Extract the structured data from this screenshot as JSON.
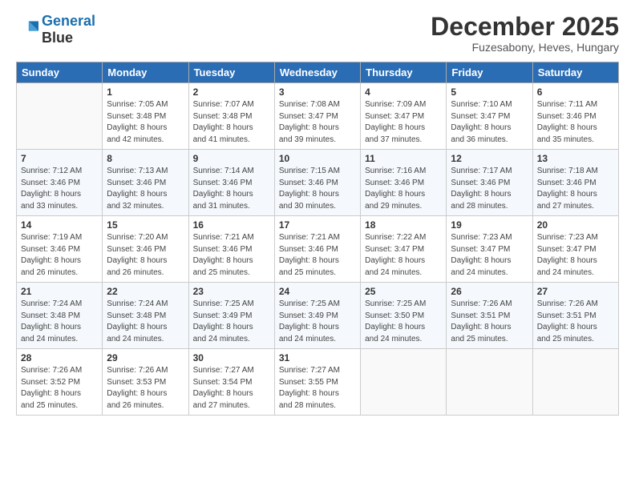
{
  "logo": {
    "line1": "General",
    "line2": "Blue"
  },
  "title": "December 2025",
  "subtitle": "Fuzesabony, Heves, Hungary",
  "days_header": [
    "Sunday",
    "Monday",
    "Tuesday",
    "Wednesday",
    "Thursday",
    "Friday",
    "Saturday"
  ],
  "weeks": [
    [
      {
        "num": "",
        "info": ""
      },
      {
        "num": "1",
        "info": "Sunrise: 7:05 AM\nSunset: 3:48 PM\nDaylight: 8 hours\nand 42 minutes."
      },
      {
        "num": "2",
        "info": "Sunrise: 7:07 AM\nSunset: 3:48 PM\nDaylight: 8 hours\nand 41 minutes."
      },
      {
        "num": "3",
        "info": "Sunrise: 7:08 AM\nSunset: 3:47 PM\nDaylight: 8 hours\nand 39 minutes."
      },
      {
        "num": "4",
        "info": "Sunrise: 7:09 AM\nSunset: 3:47 PM\nDaylight: 8 hours\nand 37 minutes."
      },
      {
        "num": "5",
        "info": "Sunrise: 7:10 AM\nSunset: 3:47 PM\nDaylight: 8 hours\nand 36 minutes."
      },
      {
        "num": "6",
        "info": "Sunrise: 7:11 AM\nSunset: 3:46 PM\nDaylight: 8 hours\nand 35 minutes."
      }
    ],
    [
      {
        "num": "7",
        "info": "Sunrise: 7:12 AM\nSunset: 3:46 PM\nDaylight: 8 hours\nand 33 minutes."
      },
      {
        "num": "8",
        "info": "Sunrise: 7:13 AM\nSunset: 3:46 PM\nDaylight: 8 hours\nand 32 minutes."
      },
      {
        "num": "9",
        "info": "Sunrise: 7:14 AM\nSunset: 3:46 PM\nDaylight: 8 hours\nand 31 minutes."
      },
      {
        "num": "10",
        "info": "Sunrise: 7:15 AM\nSunset: 3:46 PM\nDaylight: 8 hours\nand 30 minutes."
      },
      {
        "num": "11",
        "info": "Sunrise: 7:16 AM\nSunset: 3:46 PM\nDaylight: 8 hours\nand 29 minutes."
      },
      {
        "num": "12",
        "info": "Sunrise: 7:17 AM\nSunset: 3:46 PM\nDaylight: 8 hours\nand 28 minutes."
      },
      {
        "num": "13",
        "info": "Sunrise: 7:18 AM\nSunset: 3:46 PM\nDaylight: 8 hours\nand 27 minutes."
      }
    ],
    [
      {
        "num": "14",
        "info": "Sunrise: 7:19 AM\nSunset: 3:46 PM\nDaylight: 8 hours\nand 26 minutes."
      },
      {
        "num": "15",
        "info": "Sunrise: 7:20 AM\nSunset: 3:46 PM\nDaylight: 8 hours\nand 26 minutes."
      },
      {
        "num": "16",
        "info": "Sunrise: 7:21 AM\nSunset: 3:46 PM\nDaylight: 8 hours\nand 25 minutes."
      },
      {
        "num": "17",
        "info": "Sunrise: 7:21 AM\nSunset: 3:46 PM\nDaylight: 8 hours\nand 25 minutes."
      },
      {
        "num": "18",
        "info": "Sunrise: 7:22 AM\nSunset: 3:47 PM\nDaylight: 8 hours\nand 24 minutes."
      },
      {
        "num": "19",
        "info": "Sunrise: 7:23 AM\nSunset: 3:47 PM\nDaylight: 8 hours\nand 24 minutes."
      },
      {
        "num": "20",
        "info": "Sunrise: 7:23 AM\nSunset: 3:47 PM\nDaylight: 8 hours\nand 24 minutes."
      }
    ],
    [
      {
        "num": "21",
        "info": "Sunrise: 7:24 AM\nSunset: 3:48 PM\nDaylight: 8 hours\nand 24 minutes."
      },
      {
        "num": "22",
        "info": "Sunrise: 7:24 AM\nSunset: 3:48 PM\nDaylight: 8 hours\nand 24 minutes."
      },
      {
        "num": "23",
        "info": "Sunrise: 7:25 AM\nSunset: 3:49 PM\nDaylight: 8 hours\nand 24 minutes."
      },
      {
        "num": "24",
        "info": "Sunrise: 7:25 AM\nSunset: 3:49 PM\nDaylight: 8 hours\nand 24 minutes."
      },
      {
        "num": "25",
        "info": "Sunrise: 7:25 AM\nSunset: 3:50 PM\nDaylight: 8 hours\nand 24 minutes."
      },
      {
        "num": "26",
        "info": "Sunrise: 7:26 AM\nSunset: 3:51 PM\nDaylight: 8 hours\nand 25 minutes."
      },
      {
        "num": "27",
        "info": "Sunrise: 7:26 AM\nSunset: 3:51 PM\nDaylight: 8 hours\nand 25 minutes."
      }
    ],
    [
      {
        "num": "28",
        "info": "Sunrise: 7:26 AM\nSunset: 3:52 PM\nDaylight: 8 hours\nand 25 minutes."
      },
      {
        "num": "29",
        "info": "Sunrise: 7:26 AM\nSunset: 3:53 PM\nDaylight: 8 hours\nand 26 minutes."
      },
      {
        "num": "30",
        "info": "Sunrise: 7:27 AM\nSunset: 3:54 PM\nDaylight: 8 hours\nand 27 minutes."
      },
      {
        "num": "31",
        "info": "Sunrise: 7:27 AM\nSunset: 3:55 PM\nDaylight: 8 hours\nand 28 minutes."
      },
      {
        "num": "",
        "info": ""
      },
      {
        "num": "",
        "info": ""
      },
      {
        "num": "",
        "info": ""
      }
    ]
  ]
}
